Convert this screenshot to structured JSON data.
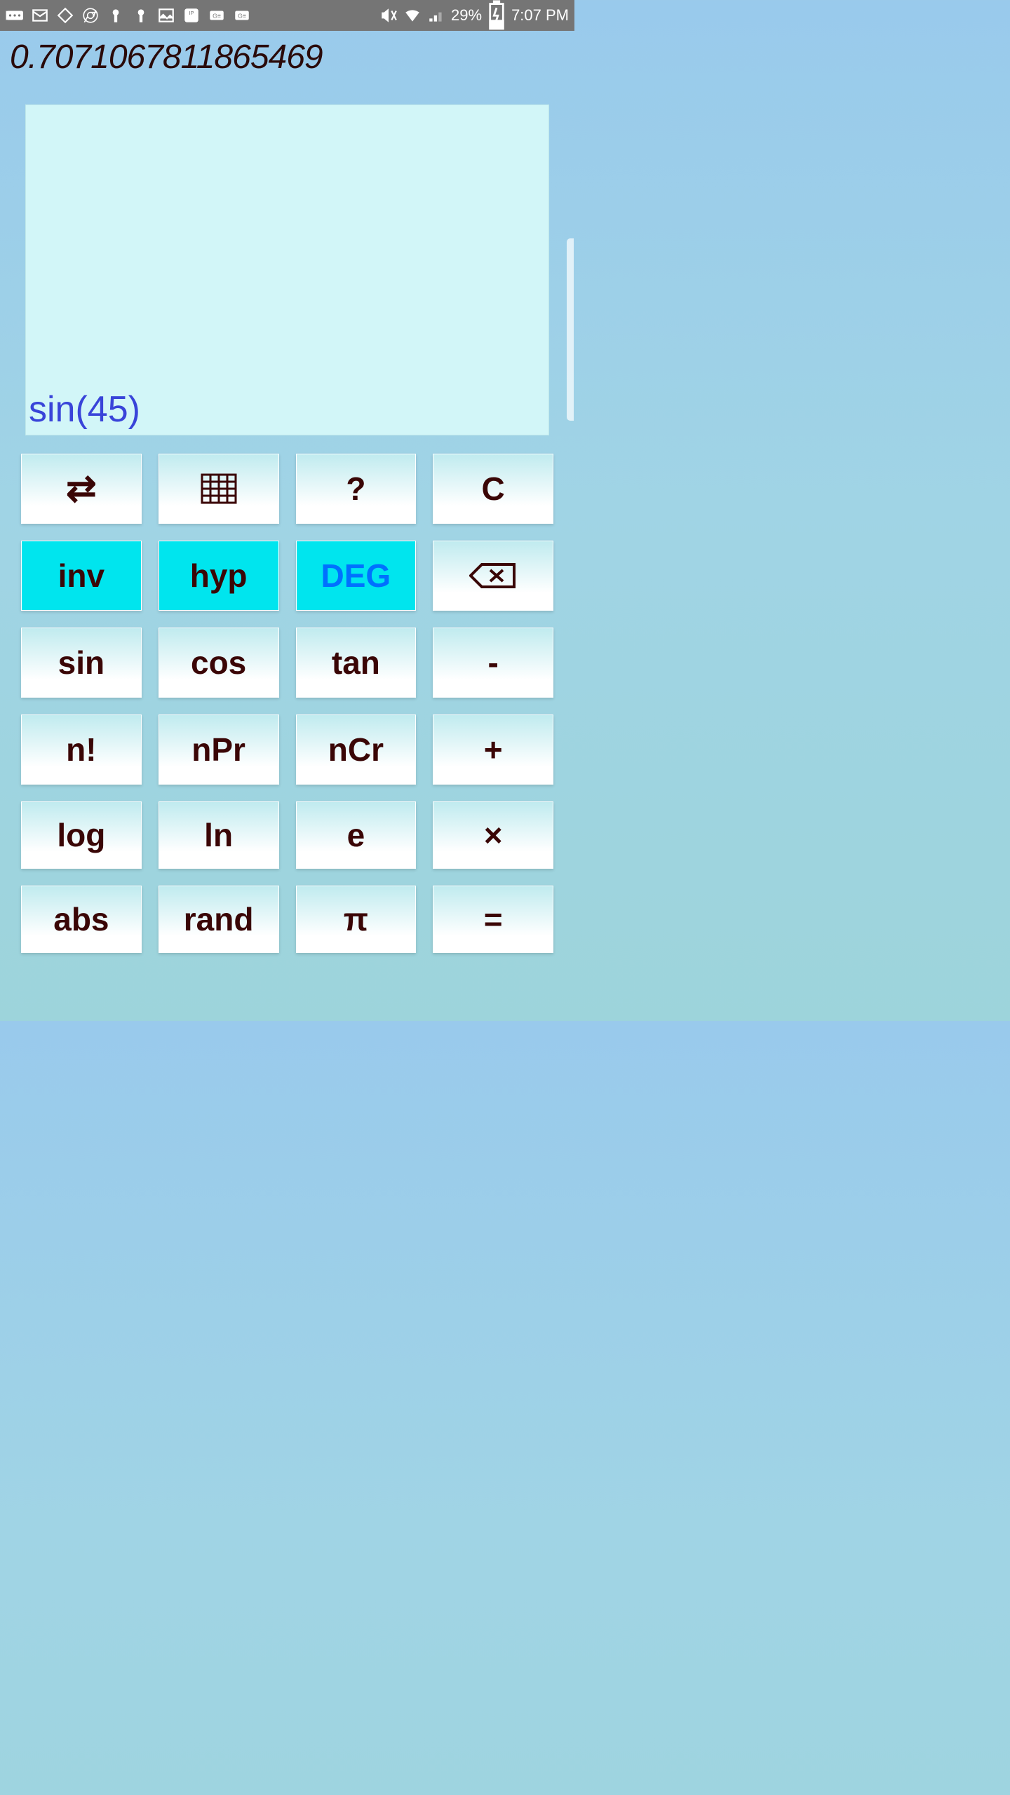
{
  "status_bar": {
    "battery_percent": "29%",
    "time": "7:07 PM"
  },
  "display": {
    "result": "0.7071067811865469",
    "expression": "sin(45)"
  },
  "buttons": {
    "row1": {
      "help": "?",
      "clear": "C"
    },
    "row2": {
      "inv": "inv",
      "hyp": "hyp",
      "deg": "DEG"
    },
    "row3": {
      "sin": "sin",
      "cos": "cos",
      "tan": "tan",
      "minus": "-"
    },
    "row4": {
      "factorial": "n!",
      "npr": "nPr",
      "ncr": "nCr",
      "plus": "+"
    },
    "row5": {
      "log": "log",
      "ln": "ln",
      "e": "e",
      "multiply": "×"
    },
    "row6": {
      "abs": "abs",
      "rand": "rand",
      "pi": "π",
      "equals": "="
    }
  }
}
